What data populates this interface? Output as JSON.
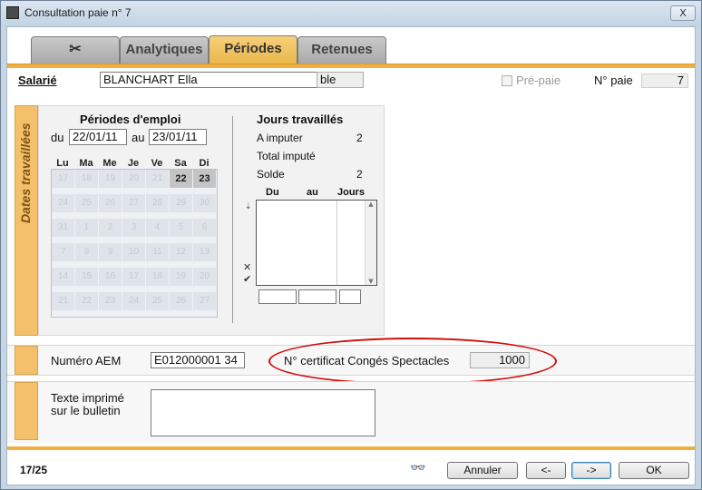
{
  "window": {
    "title": "Consultation paie n° 7",
    "close_label": "X"
  },
  "tabs": [
    {
      "label": "",
      "icon": "scissors-icon"
    },
    {
      "label": "Analytiques"
    },
    {
      "label": "Périodes"
    },
    {
      "label": "Retenues"
    }
  ],
  "header": {
    "salarie_label": "Salarié",
    "salarie_value": "BLANCHART Ella",
    "salarie_code": "ble",
    "prepaie_label": "Pré-paie",
    "prepaie_checked": false,
    "npaie_label": "N° paie",
    "npaie_value": "7"
  },
  "dates": {
    "section_label": "Dates travaillées",
    "periodes_title": "Périodes d'emploi",
    "du_label": "du",
    "du_value": "22/01/11",
    "au_label": "au",
    "au_value": "23/01/11",
    "weekdays": [
      "Lu",
      "Ma",
      "Me",
      "Je",
      "Ve",
      "Sa",
      "Di"
    ],
    "weeks": [
      [
        "17",
        "18",
        "19",
        "20",
        "21",
        "22",
        "23"
      ],
      [
        "24",
        "25",
        "26",
        "27",
        "28",
        "29",
        "30"
      ],
      [
        "31",
        "1",
        "2",
        "3",
        "4",
        "5",
        "6"
      ],
      [
        "7",
        "8",
        "9",
        "10",
        "11",
        "12",
        "13"
      ],
      [
        "14",
        "15",
        "16",
        "17",
        "18",
        "19",
        "20"
      ],
      [
        "21",
        "22",
        "23",
        "24",
        "25",
        "26",
        "27"
      ]
    ],
    "highlighted": [
      "22",
      "23"
    ],
    "jours_title": "Jours travaillés",
    "a_imputer_label": "A imputer",
    "a_imputer_value": "2",
    "total_impute_label": "Total imputé",
    "total_impute_value": "",
    "solde_label": "Solde",
    "solde_value": "2",
    "list_headers": [
      "Du",
      "au",
      "Jours"
    ]
  },
  "aem": {
    "numero_label": "Numéro AEM",
    "numero_value": "E012000001 34",
    "certificat_label": "N° certificat Congés Spectacles",
    "certificat_value": "1000"
  },
  "texte": {
    "label_line1": "Texte imprimé",
    "label_line2": "sur le bulletin",
    "value": ""
  },
  "footer": {
    "record_counter": "17/25",
    "annuler_label": "Annuler",
    "prev_label": "<-",
    "next_label": "->",
    "ok_label": "OK"
  },
  "colors": {
    "accent_orange": "#f0b040",
    "annotation_red": "#d20d0d"
  }
}
